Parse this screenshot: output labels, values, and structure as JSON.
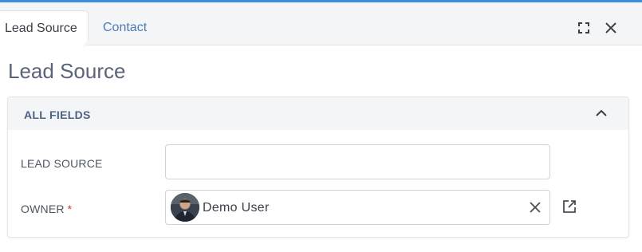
{
  "tabs": [
    {
      "label": "Lead Source",
      "active": true
    },
    {
      "label": "Contact",
      "active": false
    }
  ],
  "toolbar": {
    "expand_icon": "expand-icon",
    "close_icon": "close-icon"
  },
  "page": {
    "title": "Lead Source"
  },
  "section": {
    "title": "ALL FIELDS",
    "toggle_icon": "chevron-up-icon"
  },
  "fields": {
    "lead_source": {
      "label": "LEAD SOURCE",
      "value": ""
    },
    "owner": {
      "label": "OWNER",
      "required_mark": "*",
      "value": "Demo User",
      "clear_icon": "close-icon",
      "link_icon": "open-in-new-icon"
    }
  },
  "colors": {
    "accent": "#3c8dde",
    "link": "#4a7bb5",
    "section_header": "#4c6386",
    "required": "#d9363e"
  }
}
